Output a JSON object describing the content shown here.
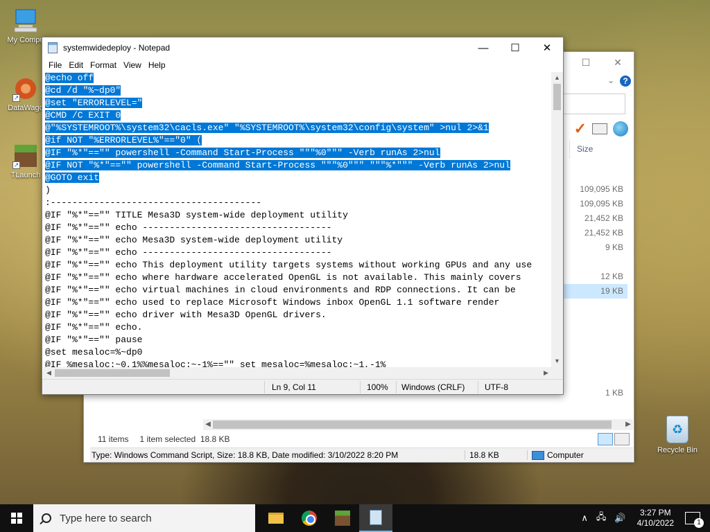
{
  "desktop": {
    "icons": [
      {
        "label": "My Compu"
      },
      {
        "label": "DataWago"
      },
      {
        "label": "TLaunch"
      }
    ],
    "recycle_bin": {
      "label": "Recycle Bin"
    }
  },
  "explorer": {
    "column_header": "Size",
    "sizes": [
      "109,095 KB",
      "109,095 KB",
      "21,452 KB",
      "21,452 KB",
      "9 KB",
      "",
      "12 KB",
      "19 KB",
      "",
      "",
      "",
      "",
      "",
      "",
      "1 KB"
    ],
    "selected_index": 7,
    "status": {
      "item_count": "11 items",
      "selection": "1 item selected",
      "selection_size": "18.8 KB"
    },
    "details": {
      "description": "Type: Windows Command Script, Size: 18.8 KB, Date modified: 3/10/2022 8:20 PM",
      "size": "18.8 KB",
      "location": "Computer"
    }
  },
  "notepad": {
    "title": "systemwidedeploy - Notepad",
    "menu": [
      "File",
      "Edit",
      "Format",
      "View",
      "Help"
    ],
    "lines": [
      {
        "text": "@echo off",
        "selected": true
      },
      {
        "text": "@cd /d \"%~dp0\"",
        "selected": true
      },
      {
        "text": "@set \"ERRORLEVEL=\"",
        "selected": true
      },
      {
        "text": "@CMD /C EXIT 0",
        "selected": true
      },
      {
        "text": "@\"%SYSTEMROOT%\\system32\\cacls.exe\" \"%SYSTEMROOT%\\system32\\config\\system\" >nul 2>&1",
        "selected": true
      },
      {
        "text": "@if NOT \"%ERRORLEVEL%\"==\"0\" (",
        "selected": true
      },
      {
        "text": "@IF \"%*\"==\"\" powershell -Command Start-Process \"\"\"%0\"\"\" -Verb runAs 2>nul",
        "selected": true
      },
      {
        "text": "@IF NOT \"%*\"==\"\" powershell -Command Start-Process \"\"\"%0\"\"\" \"\"\"%*\"\"\" -Verb runAs 2>nul",
        "selected": true
      },
      {
        "text": "@GOTO exit",
        "selected": true
      },
      {
        "text": ")",
        "selected": false
      },
      {
        "text": ":---------------------------------------",
        "selected": false
      },
      {
        "text": "@IF \"%*\"==\"\" TITLE Mesa3D system-wide deployment utility",
        "selected": false
      },
      {
        "text": "@IF \"%*\"==\"\" echo -----------------------------------",
        "selected": false
      },
      {
        "text": "@IF \"%*\"==\"\" echo Mesa3D system-wide deployment utility",
        "selected": false
      },
      {
        "text": "@IF \"%*\"==\"\" echo -----------------------------------",
        "selected": false
      },
      {
        "text": "@IF \"%*\"==\"\" echo This deployment utility targets systems without working GPUs and any use",
        "selected": false
      },
      {
        "text": "@IF \"%*\"==\"\" echo where hardware accelerated OpenGL is not available. This mainly covers",
        "selected": false
      },
      {
        "text": "@IF \"%*\"==\"\" echo virtual machines in cloud environments and RDP connections. It can be",
        "selected": false
      },
      {
        "text": "@IF \"%*\"==\"\" echo used to replace Microsoft Windows inbox OpenGL 1.1 software render",
        "selected": false
      },
      {
        "text": "@IF \"%*\"==\"\" echo driver with Mesa3D OpenGL drivers.",
        "selected": false
      },
      {
        "text": "@IF \"%*\"==\"\" echo.",
        "selected": false
      },
      {
        "text": "@IF \"%*\"==\"\" pause",
        "selected": false
      },
      {
        "text": "@set mesaloc=%~dp0",
        "selected": false
      },
      {
        "text": "@IF %mesaloc:~0,1%%mesaloc:~-1%==\"\" set mesaloc=%mesaloc:~1,-1%",
        "selected": false
      }
    ],
    "status": {
      "position": "Ln 9, Col 11",
      "zoom": "100%",
      "line_endings": "Windows (CRLF)",
      "encoding": "UTF-8"
    }
  },
  "taskbar": {
    "search_placeholder": "Type here to search",
    "time": "3:27 PM",
    "date": "4/10/2022",
    "notification_count": "1"
  }
}
